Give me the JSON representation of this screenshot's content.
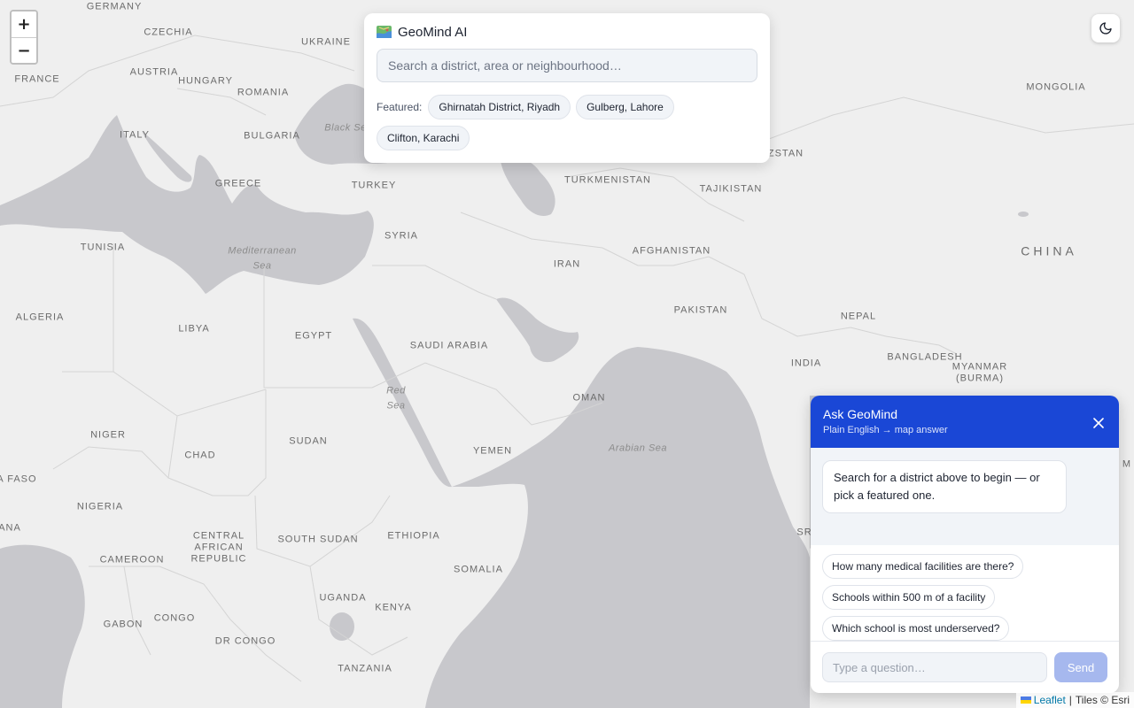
{
  "app": {
    "name": "GeoMind AI",
    "logo_icon": "map-icon"
  },
  "search": {
    "placeholder": "Search a district, area or neighbourhood…",
    "featured_label": "Featured:",
    "featured": [
      "Ghirnatah District, Riyadh",
      "Gulberg, Lahore",
      "Clifton, Karachi"
    ]
  },
  "zoom": {
    "in": "+",
    "out": "−"
  },
  "theme_toggle": {
    "icon": "moon-icon"
  },
  "ask": {
    "title": "Ask GeoMind",
    "subtitle": "Plain English → map answer",
    "close_icon": "close-icon",
    "welcome": "Search for a district above to begin — or pick a featured one.",
    "suggestions": [
      "How many medical facilities are there?",
      "Schools within 500 m of a facility",
      "Which school is most underserved?"
    ],
    "input_placeholder": "Type a question…",
    "send_label": "Send"
  },
  "attribution": {
    "leaflet": "Leaflet",
    "separator": "|",
    "tiles": "Tiles © Esri"
  },
  "map": {
    "colors": {
      "land": "#efefef",
      "water": "#c8c8cc",
      "border": "#d4d4d4"
    },
    "labels": {
      "germany": "GERMANY",
      "czechia": "CZECHIA",
      "ukraine": "UKRAINE",
      "austria": "AUSTRIA",
      "hungary": "HUNGARY",
      "france": "FRANCE",
      "romania": "ROMANIA",
      "italy": "ITALY",
      "bulgaria": "BULGARIA",
      "black_sea": "Black Se",
      "greece": "GREECE",
      "turkey": "TURKEY",
      "turkmenistan": "TURKMENISTAN",
      "tajikistan": "TAJIKISTAN",
      "kazakhstan": "ZSTAN",
      "mongolia": "MONGOLIA",
      "china": "CHINA",
      "tunisia": "TUNISIA",
      "mediterranean": "Mediterranean",
      "mediterranean_2": "Sea",
      "syria": "SYRIA",
      "iran": "IRAN",
      "afghanistan": "AFGHANISTAN",
      "algeria": "ALGERIA",
      "libya": "LIBYA",
      "egypt": "EGYPT",
      "pakistan": "PAKISTAN",
      "nepal": "NEPAL",
      "saudi_arabia": "SAUDI ARABIA",
      "india": "INDIA",
      "bangladesh": "BANGLADESH",
      "myanmar": "MYANMAR",
      "myanmar_2": "(BURMA)",
      "red_sea": "Red",
      "red_sea_2": "Sea",
      "oman": "OMAN",
      "niger": "NIGER",
      "chad": "CHAD",
      "sudan": "SUDAN",
      "yemen": "YEMEN",
      "arabian_sea": "Arabian Sea",
      "burkina_faso": "A FASO",
      "nigeria": "NIGERIA",
      "ghana": "ANA",
      "car": "CENTRAL",
      "car_2": "AFRICAN",
      "car_3": "REPUBLIC",
      "south_sudan": "SOUTH SUDAN",
      "ethiopia": "ETHIOPIA",
      "cameroon": "CAMEROON",
      "somalia": "SOMALIA",
      "sri_lanka": "SR",
      "uganda": "UGANDA",
      "kenya": "KENYA",
      "gabon": "GABON",
      "congo": "CONGO",
      "dr_congo": "DR CONGO",
      "tanzania": "TANZANIA",
      "right_edge": "M"
    }
  }
}
